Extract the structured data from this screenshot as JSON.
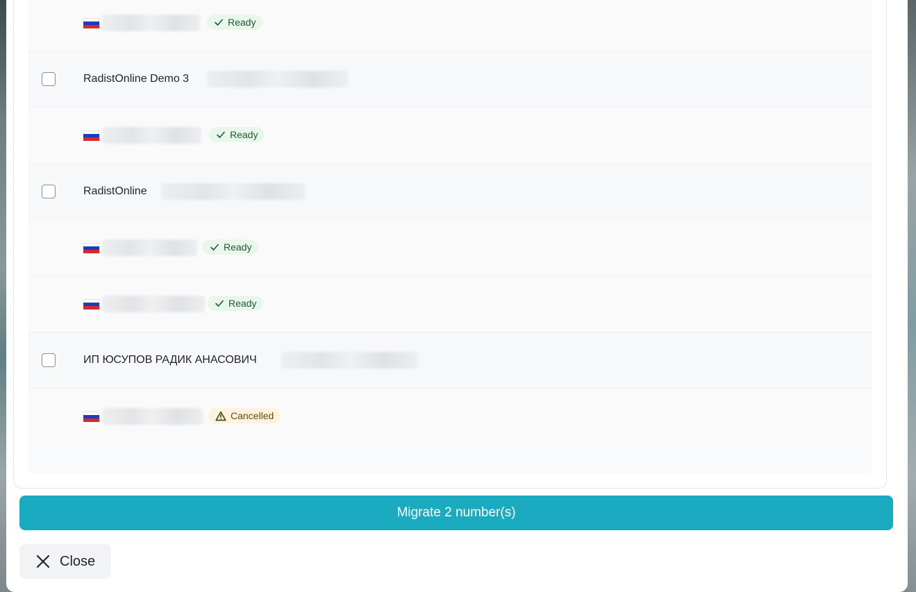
{
  "accounts_list": {
    "rows": [
      {
        "type": "number",
        "status": "Ready",
        "status_kind": "ready"
      },
      {
        "type": "account",
        "name": "RadistOnline Demo 3"
      },
      {
        "type": "number",
        "status": "Ready",
        "status_kind": "ready"
      },
      {
        "type": "account",
        "name": "RadistOnline"
      },
      {
        "type": "number",
        "status": "Ready",
        "status_kind": "ready"
      },
      {
        "type": "number",
        "status": "Ready",
        "status_kind": "ready"
      },
      {
        "type": "account",
        "name": "ИП ЮСУПОВ РАДИК АНАСОВИЧ"
      },
      {
        "type": "number",
        "status": "Cancelled",
        "status_kind": "cancelled"
      }
    ]
  },
  "footer": {
    "migrate_label": "Migrate 2 number(s)",
    "close_label": "Close"
  },
  "icons": {
    "ready": "check-icon",
    "cancelled": "warning-triangle-icon",
    "close": "close-icon",
    "flag": "russia-flag-icon"
  },
  "colors": {
    "primary": "#1aabc1",
    "ready_bg": "#e8f6ec",
    "ready_text": "#1e5a32",
    "cancelled_bg": "#fcf3dc",
    "cancelled_text": "#6b4a10"
  }
}
